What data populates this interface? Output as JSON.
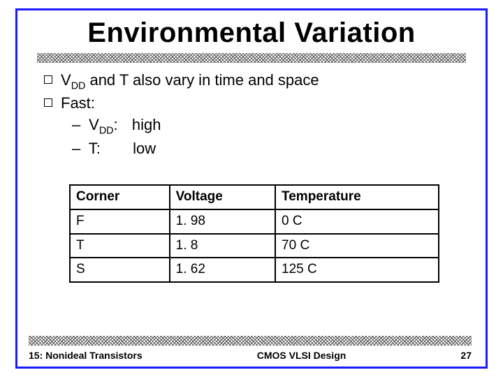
{
  "title": "Environmental Variation",
  "bullets": {
    "line1_pre": "V",
    "line1_sub": "DD",
    "line1_post": " and T also vary in time and space",
    "line2": "Fast:",
    "sub1_pre": "V",
    "sub1_sub": "DD",
    "sub1_sep": ":",
    "sub1_val": "high",
    "sub2_key": "T:",
    "sub2_val": "low"
  },
  "table": {
    "headers": {
      "c0": "Corner",
      "c1": "Voltage",
      "c2": "Temperature"
    },
    "rows": [
      {
        "c0": "F",
        "c1": "1. 98",
        "c2": "0 C"
      },
      {
        "c0": "T",
        "c1": "1. 8",
        "c2": "70 C"
      },
      {
        "c0": "S",
        "c1": "1. 62",
        "c2": "125 C"
      }
    ]
  },
  "footer": {
    "left": "15: Nonideal Transistors",
    "center": "CMOS VLSI Design",
    "right": "27"
  },
  "chart_data": {
    "type": "table",
    "title": "Environmental Variation — Corner conditions",
    "columns": [
      "Corner",
      "Voltage",
      "Temperature"
    ],
    "rows": [
      [
        "F",
        "1.98",
        "0 C"
      ],
      [
        "T",
        "1.8",
        "70 C"
      ],
      [
        "S",
        "1.62",
        "125 C"
      ]
    ]
  }
}
